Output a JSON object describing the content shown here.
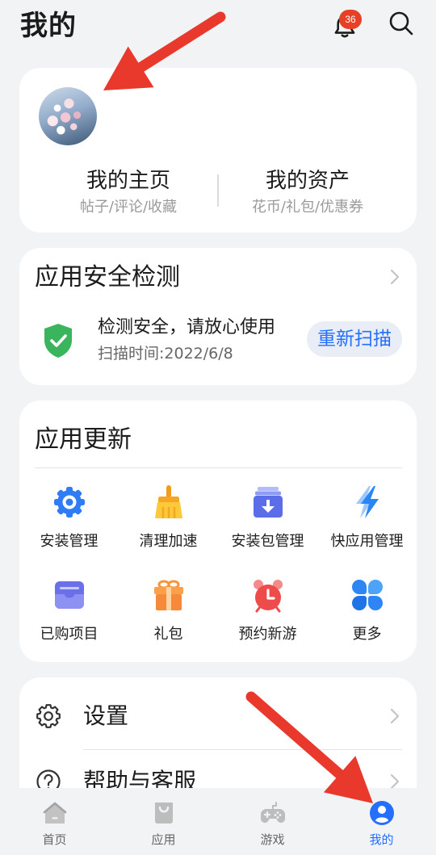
{
  "header": {
    "title": "我的",
    "notification_badge": "36",
    "icons": {
      "notification": "bell-icon",
      "search": "search-icon"
    }
  },
  "profile_card": {
    "links": [
      {
        "label": "我的主页",
        "subtitle": "帖子/评论/收藏"
      },
      {
        "label": "我的资产",
        "subtitle": "花币/礼包/优惠券"
      }
    ]
  },
  "security_card": {
    "title": "应用安全检测",
    "status_icon": "shield-check-icon",
    "status_text": "检测安全，请放心使用",
    "scan_time": "扫描时间:2022/6/8",
    "rescan_button": "重新扫描"
  },
  "updates_card": {
    "title": "应用更新",
    "items": [
      {
        "label": "安装管理",
        "icon": "gear-icon"
      },
      {
        "label": "清理加速",
        "icon": "broom-icon"
      },
      {
        "label": "安装包管理",
        "icon": "package-download-icon"
      },
      {
        "label": "快应用管理",
        "icon": "lightning-icon"
      },
      {
        "label": "已购项目",
        "icon": "purchased-icon"
      },
      {
        "label": "礼包",
        "icon": "gift-icon"
      },
      {
        "label": "预约新游",
        "icon": "alarm-clock-icon"
      },
      {
        "label": "更多",
        "icon": "more-icon"
      }
    ]
  },
  "settings_card": {
    "items": [
      {
        "label": "设置",
        "icon": "settings-icon"
      },
      {
        "label": "帮助与客服",
        "icon": "help-icon"
      }
    ]
  },
  "tab_bar": {
    "active_index": 3,
    "items": [
      {
        "label": "首页",
        "icon": "home-icon"
      },
      {
        "label": "应用",
        "icon": "apps-bag-icon"
      },
      {
        "label": "游戏",
        "icon": "gamepad-icon"
      },
      {
        "label": "我的",
        "icon": "profile-icon"
      }
    ]
  },
  "colors": {
    "accent": "#256FFF",
    "badge": "#E84026",
    "shield": "#3BB55D",
    "annotation": "#E8392C",
    "background": "#F1F3F5"
  }
}
